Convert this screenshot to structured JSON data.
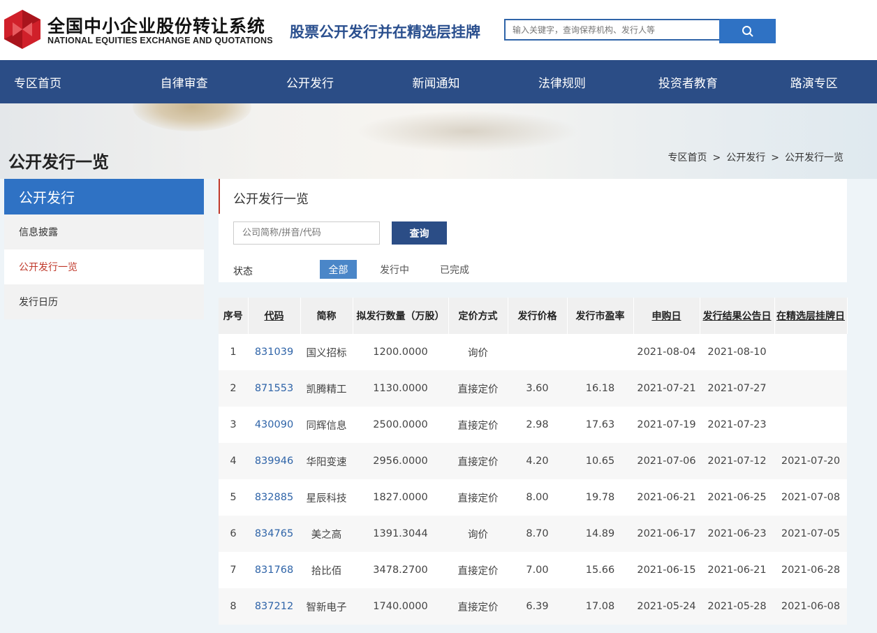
{
  "header": {
    "logo_cn": "全国中小企业股份转让系统",
    "logo_en": "NATIONAL EQUITIES EXCHANGE AND QUOTATIONS",
    "slogan": "股票公开发行并在精选层挂牌",
    "search_placeholder": "输入关键字，查询保荐机构、发行人等",
    "search_icon": "search-icon",
    "logo_color": "#d0202a"
  },
  "nav": {
    "items": [
      "专区首页",
      "自律审查",
      "公开发行",
      "新闻通知",
      "法律规则",
      "投资者教育",
      "路演专区"
    ],
    "bg_color": "#2b4d86"
  },
  "page": {
    "title": "公开发行一览",
    "breadcrumb": [
      "专区首页",
      ">",
      "公开发行",
      ">",
      "公开发行一览"
    ]
  },
  "sidebar": {
    "heading": "公开发行",
    "items": [
      {
        "label": "信息披露",
        "active": false
      },
      {
        "label": "公开发行一览",
        "active": true
      },
      {
        "label": "发行日历",
        "active": false
      }
    ],
    "accent_color": "#2f72c4"
  },
  "main": {
    "title": "公开发行一览",
    "filter_placeholder": "公司简称/拼音/代码",
    "query_label": "查询",
    "status_label": "状态",
    "status_options": [
      "全部",
      "发行中",
      "已完成"
    ],
    "status_selected": "全部"
  },
  "table": {
    "columns": [
      "序号",
      "代码",
      "简称",
      "拟发行数量（万股）",
      "定价方式",
      "发行价格",
      "发行市盈率",
      "申购日",
      "发行结果公告日",
      "在精选层挂牌日"
    ],
    "rows": [
      [
        "1",
        "831039",
        "国义招标",
        "1200.0000",
        "询价",
        "",
        "",
        "2021-08-04",
        "2021-08-10",
        ""
      ],
      [
        "2",
        "871553",
        "凯腾精工",
        "1130.0000",
        "直接定价",
        "3.60",
        "16.18",
        "2021-07-21",
        "2021-07-27",
        ""
      ],
      [
        "3",
        "430090",
        "同辉信息",
        "2500.0000",
        "直接定价",
        "2.98",
        "17.63",
        "2021-07-19",
        "2021-07-23",
        ""
      ],
      [
        "4",
        "839946",
        "华阳变速",
        "2956.0000",
        "直接定价",
        "4.20",
        "10.65",
        "2021-07-06",
        "2021-07-12",
        "2021-07-20"
      ],
      [
        "5",
        "832885",
        "星辰科技",
        "1827.0000",
        "直接定价",
        "8.00",
        "19.78",
        "2021-06-21",
        "2021-06-25",
        "2021-07-08"
      ],
      [
        "6",
        "834765",
        "美之高",
        "1391.3044",
        "询价",
        "8.70",
        "14.89",
        "2021-06-17",
        "2021-06-23",
        "2021-07-05"
      ],
      [
        "7",
        "831768",
        "拾比佰",
        "3478.2700",
        "直接定价",
        "7.00",
        "15.66",
        "2021-06-15",
        "2021-06-21",
        "2021-06-28"
      ],
      [
        "8",
        "837212",
        "智新电子",
        "1740.0000",
        "直接定价",
        "6.39",
        "17.08",
        "2021-05-24",
        "2021-05-28",
        "2021-06-08"
      ]
    ]
  }
}
